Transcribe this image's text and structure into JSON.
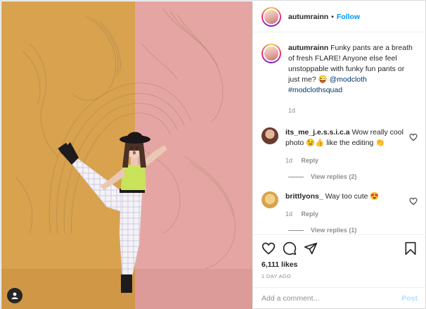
{
  "post": {
    "image_alt": "Woman in white plaid flared pants kicking one leg up against an orange and pink wall",
    "user_tag_icon": "user-tag-icon"
  },
  "header": {
    "username": "autumrainn",
    "separator": "•",
    "follow_label": "Follow",
    "more_label": "..."
  },
  "caption": {
    "username": "autumrainn",
    "text": "Funky pants are a breath of fresh FLARE! Anyone else feel unstoppable with funky fun pants or just me? 😜",
    "mention": "@modcloth",
    "hashtag": "#modclothsquad",
    "time": "1d"
  },
  "comments": [
    {
      "username": "its_me_j.e.s.s.i.c.a",
      "text": "Wow really cool photo 😉👍 like the editing 👏",
      "time": "1d",
      "reply_label": "Reply",
      "view_replies": "View replies (2)"
    },
    {
      "username": "brittlyons_",
      "text": "Way too cute 😍",
      "time": "1d",
      "reply_label": "Reply",
      "view_replies": "View replies (1)"
    }
  ],
  "actions": {
    "likes": "6,111 likes",
    "ago": "1 DAY AGO",
    "icons": [
      "heart-icon",
      "comment-icon",
      "share-icon",
      "bookmark-icon"
    ]
  },
  "composer": {
    "placeholder": "Add a comment...",
    "post_label": "Post"
  },
  "colors": {
    "link": "#0095f6",
    "mention": "#00376b",
    "wall_left": "#d8a24e",
    "wall_right": "#e5a6a3"
  }
}
